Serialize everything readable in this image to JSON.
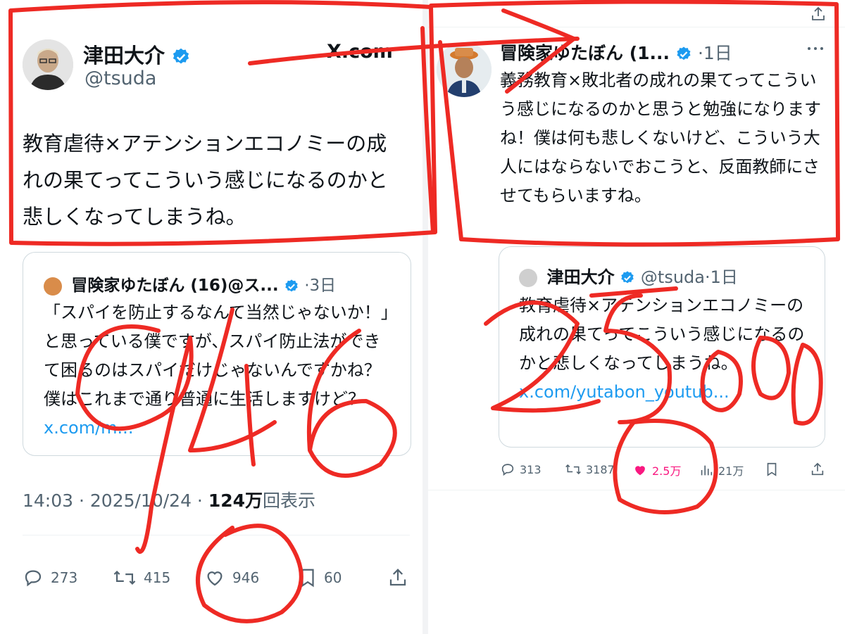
{
  "left": {
    "author": {
      "name": "津田大介",
      "handle": "@tsuda",
      "source": "X.com"
    },
    "text": "教育虐待×アテンションエコノミーの成れの果てってこういう感じになるのかと悲しくなってしまうね。",
    "quote": {
      "name": "冒険家ゆたぼん (16)@ス...",
      "time": "3日",
      "text": "「スパイを防止するなんて当然じゃないか！」と思っている僕ですが、スパイ防止法ができて困るのはスパイだけじゃないんですかね？僕はこれまで通り普通に生活しますけど？",
      "link": "x.com/m..."
    },
    "meta": {
      "timestamp": "14:03 · 2025/10/24 · ",
      "views": "124万",
      "views_suffix": "回表示"
    },
    "actions": {
      "replies": "273",
      "reposts": "415",
      "likes": "946",
      "bookmarks": "60"
    }
  },
  "right": {
    "author": {
      "name": "冒険家ゆたぼん (1...",
      "time": "1日"
    },
    "text": "義務教育×敗北者の成れの果てってこういう感じになるのかと思うと勉強になりますね！僕は何も悲しくないけど、こういう大人にはならないでおこうと、反面教師にさせてもらいますね。",
    "quote": {
      "name": "津田大介",
      "handle": "@tsuda",
      "time": "1日",
      "text": "教育虐待×アテンションエコノミーの成れの果てってこういう感じになるのかと悲しくなってしまうね。",
      "link": "x.com/yutabon_youtub..."
    },
    "actions": {
      "replies": "313",
      "reposts": "3187",
      "likes": "2.5万",
      "views": "21万"
    }
  },
  "annotations": {
    "left_number": "946",
    "right_number": "25000"
  },
  "colors": {
    "annotation": "#ee2a24",
    "link": "#1d9bf0",
    "like_active": "#f91880",
    "verified": "#1d9bf0"
  }
}
